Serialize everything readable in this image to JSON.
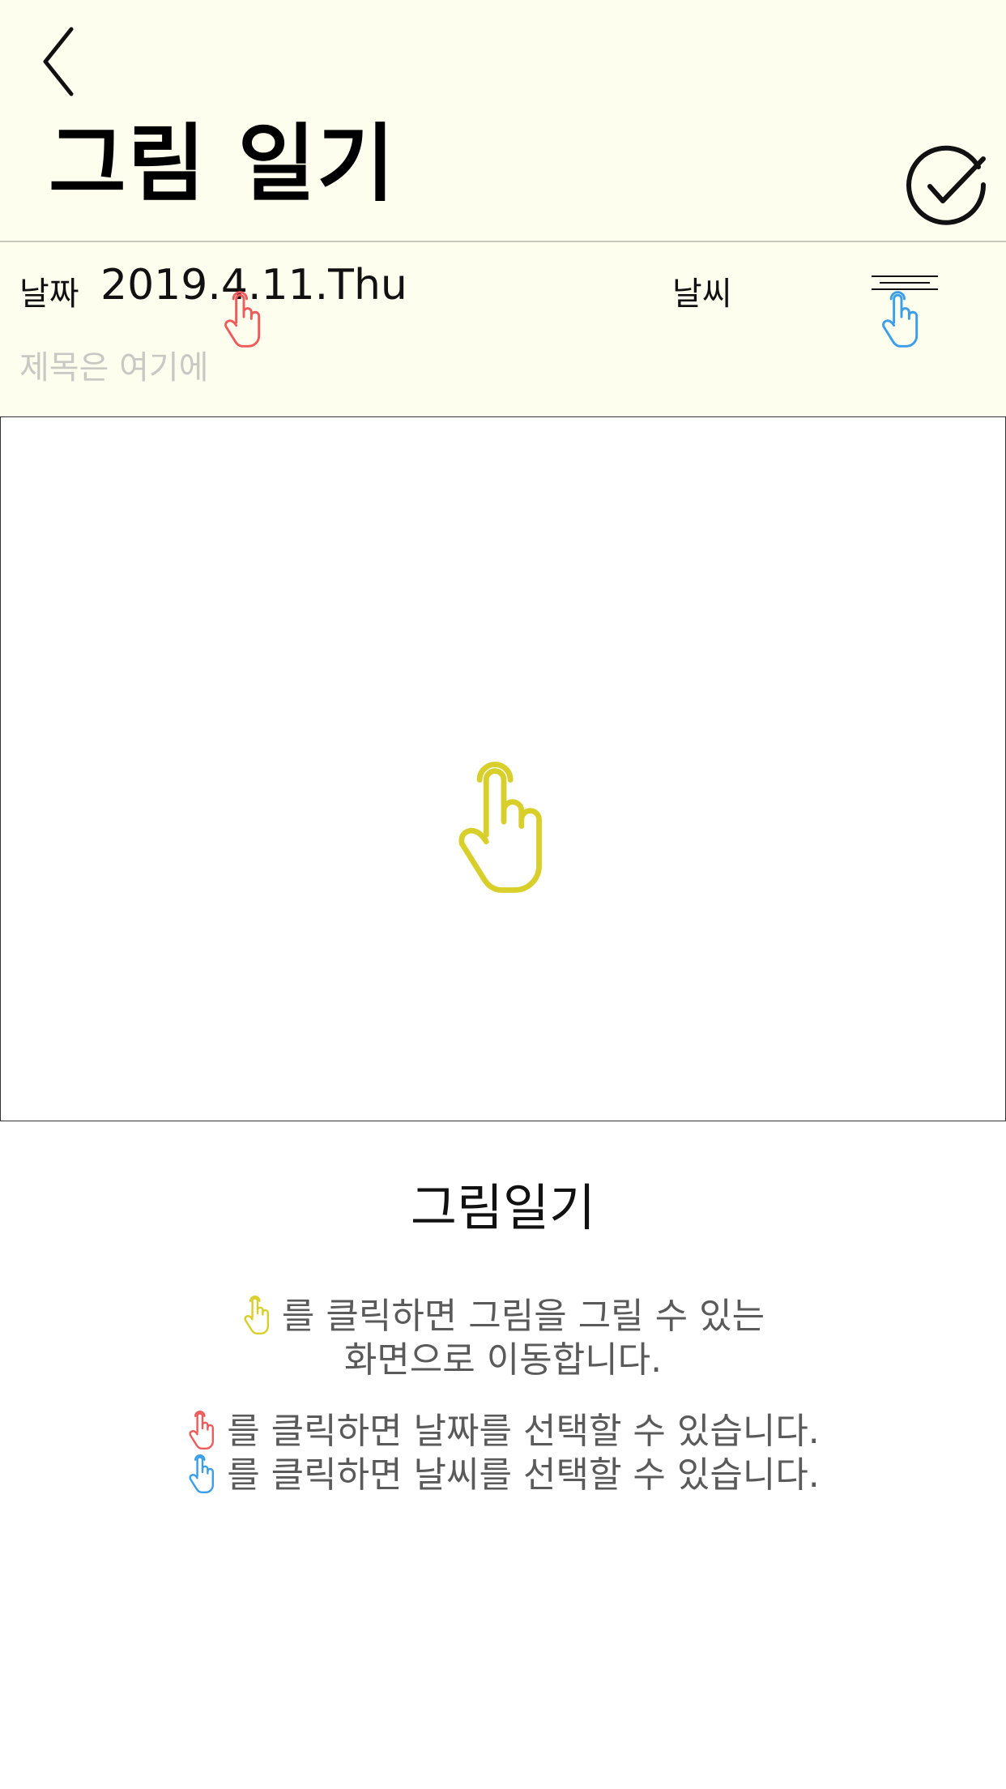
{
  "header": {
    "title": "그림 일기",
    "back_icon": "chevron-left-icon",
    "done_icon": "check-circle-icon"
  },
  "meta": {
    "date_label": "날짜",
    "date_value": "2019.4.11.Thu",
    "weather_label": "날씨",
    "weather_icon": "weather-lines-icon",
    "title_placeholder": "제목은 여기에"
  },
  "canvas": {
    "hand_icon": "pointing-hand-icon"
  },
  "colors": {
    "header_bg": "#fefeef",
    "draw_hint": "#d9cf2a",
    "date_hint": "#ef5b5b",
    "weather_hint": "#3a9ee8"
  },
  "info": {
    "title": "그림일기",
    "line1a": "를 클릭하면 그림을 그릴 수 있는",
    "line1b": "화면으로 이동합니다.",
    "line2": "를 클릭하면 날짜를 선택할 수 있습니다.",
    "line3": "를 클릭하면 날씨를 선택할 수 있습니다."
  }
}
